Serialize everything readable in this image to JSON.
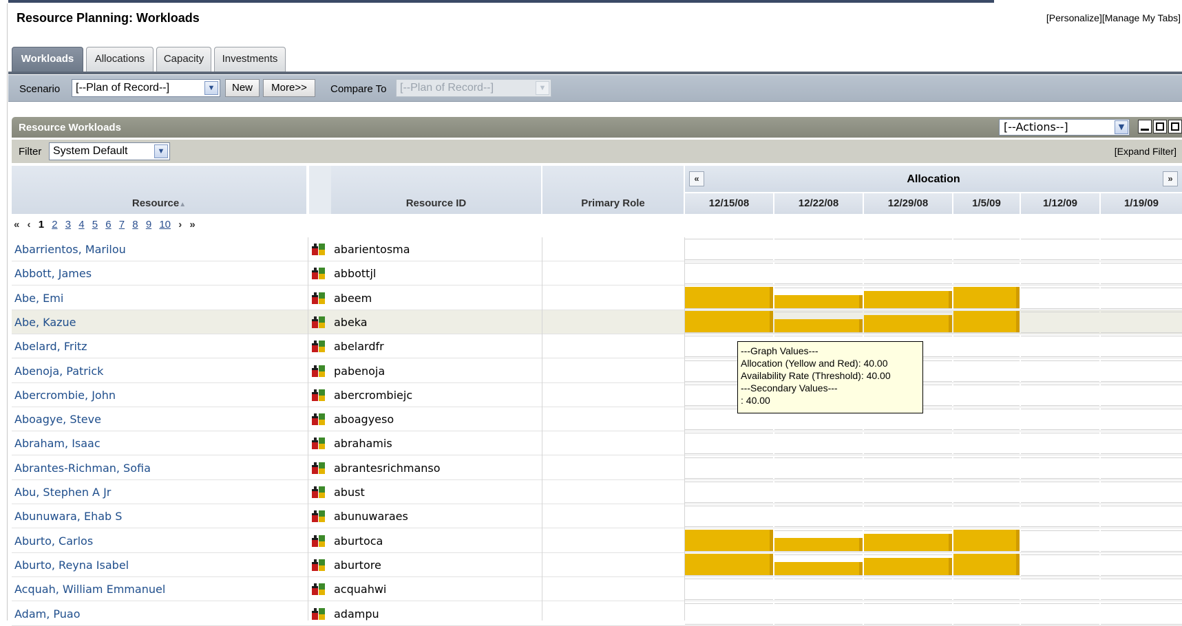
{
  "page": {
    "title": "Resource Planning: Workloads",
    "links": [
      "[Personalize]",
      "[Manage My Tabs]"
    ]
  },
  "tabs": [
    {
      "label": "Workloads",
      "active": true
    },
    {
      "label": "Allocations",
      "active": false
    },
    {
      "label": "Capacity",
      "active": false
    },
    {
      "label": "Investments",
      "active": false
    }
  ],
  "scenario": {
    "label": "Scenario",
    "value": "[--Plan of Record--]",
    "new_label": "New",
    "more_label": "More>>",
    "compare_label": "Compare To",
    "compare_value": "[--Plan of Record--]"
  },
  "portlet": {
    "title": "Resource Workloads",
    "actions_value": "[--Actions--]",
    "filter_label": "Filter",
    "filter_value": "System Default",
    "expand_label": "[Expand Filter]"
  },
  "columns": {
    "resource": "Resource",
    "resource_id": "Resource ID",
    "primary_role": "Primary Role",
    "allocation": "Allocation",
    "weeks": [
      "12/15/08",
      "12/22/08",
      "12/29/08",
      "1/5/09",
      "1/12/09",
      "1/19/09"
    ]
  },
  "pager": {
    "first": "«",
    "prev": "‹",
    "pages": [
      "1",
      "2",
      "3",
      "4",
      "5",
      "6",
      "7",
      "8",
      "9",
      "10"
    ],
    "current": "1",
    "next": "›",
    "last": "»"
  },
  "rows": [
    {
      "name": "Abarrientos, Marilou",
      "id": "abarientosma",
      "alloc": [
        0,
        0,
        0,
        0,
        0,
        0
      ]
    },
    {
      "name": "Abbott, James",
      "id": "abbottjl",
      "alloc": [
        0,
        0,
        0,
        0,
        0,
        0
      ]
    },
    {
      "name": "Abe, Emi",
      "id": "abeem",
      "alloc": [
        40,
        24,
        32,
        40,
        0,
        0
      ]
    },
    {
      "name": "Abe, Kazue",
      "id": "abeka",
      "alloc": [
        40,
        24,
        32,
        40,
        0,
        0
      ],
      "highlight": true
    },
    {
      "name": "Abelard, Fritz",
      "id": "abelardfr",
      "alloc": [
        0,
        0,
        0,
        0,
        0,
        0
      ]
    },
    {
      "name": "Abenoja, Patrick",
      "id": "pabenoja",
      "alloc": [
        0,
        0,
        0,
        0,
        0,
        0
      ]
    },
    {
      "name": "Abercrombie, John",
      "id": "abercrombiejc",
      "alloc": [
        0,
        0,
        0,
        0,
        0,
        0
      ]
    },
    {
      "name": "Aboagye, Steve",
      "id": "aboagyeso",
      "alloc": [
        0,
        0,
        0,
        0,
        0,
        0
      ]
    },
    {
      "name": "Abraham, Isaac",
      "id": "abrahamis",
      "alloc": [
        0,
        0,
        0,
        0,
        0,
        0
      ]
    },
    {
      "name": "Abrantes-Richman, Sofia",
      "id": "abrantesrichmanso",
      "alloc": [
        0,
        0,
        0,
        0,
        0,
        0
      ]
    },
    {
      "name": "Abu, Stephen A Jr",
      "id": "abust",
      "alloc": [
        0,
        0,
        0,
        0,
        0,
        0
      ]
    },
    {
      "name": "Abunuwara, Ehab S",
      "id": "abunuwaraes",
      "alloc": [
        0,
        0,
        0,
        0,
        0,
        0
      ]
    },
    {
      "name": "Aburto, Carlos",
      "id": "aburtoca",
      "alloc": [
        40,
        24,
        32,
        40,
        0,
        0
      ]
    },
    {
      "name": "Aburto, Reyna Isabel",
      "id": "aburtore",
      "alloc": [
        40,
        24,
        32,
        40,
        0,
        0
      ]
    },
    {
      "name": "Acquah, William Emmanuel",
      "id": "acquahwi",
      "alloc": [
        0,
        0,
        0,
        0,
        0,
        0
      ]
    },
    {
      "name": "Adam, Puao",
      "id": "adampu",
      "alloc": [
        0,
        0,
        0,
        0,
        0,
        0
      ]
    }
  ],
  "tooltip": {
    "lines": [
      "---Graph Values---",
      "Allocation (Yellow and Red): 40.00",
      "Availability Rate (Threshold): 40.00",
      "---Secondary Values---",
      ": 40.00"
    ]
  },
  "colors": {
    "bar": "#e9b600",
    "bar_edge": "#d09b00",
    "header": "#d3dbe6",
    "portlet": "#85877a"
  },
  "icons": {
    "resource": "resource-person-icon",
    "sort": "sort-ascending-icon"
  }
}
